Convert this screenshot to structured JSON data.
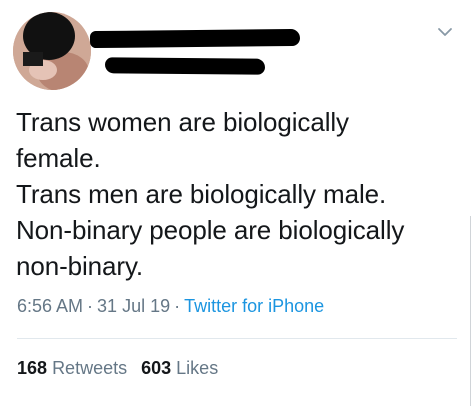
{
  "tweet": {
    "lines": [
      "Trans women are biologically",
      "female.",
      "Trans men are biologically male.",
      "Non-binary people are biologically",
      "non-binary."
    ],
    "time": "6:56 AM",
    "date": "31 Jul 19",
    "source": "Twitter for iPhone",
    "separator": "·",
    "retweets_count": "168",
    "retweets_label": "Retweets",
    "likes_count": "603",
    "likes_label": "Likes"
  },
  "icons": {
    "menu": "chevron-down-icon"
  },
  "colors": {
    "text": "#14171a",
    "muted": "#657786",
    "link": "#1b95e0",
    "divider": "#e1e8ed"
  }
}
